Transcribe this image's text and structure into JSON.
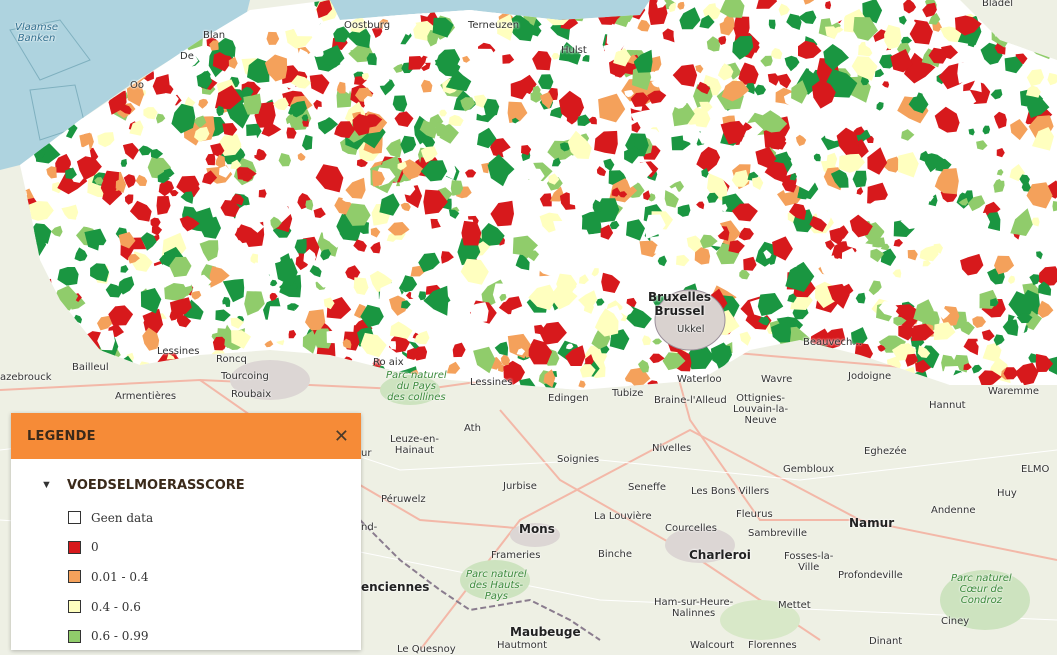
{
  "map": {
    "place_labels": {
      "vlaamse_banken": "Vlaamse\nBanken",
      "oostburg": "Oostburg",
      "terneuzen": "Terneuzen",
      "hulst": "Hulst",
      "bladel": "Bladel",
      "blan": "Blan",
      "de": "De",
      "oo": "Oo",
      "bruxelles": "Bruxelles\nBrussel",
      "ukkel": "Ukkel",
      "lessines1": "Lessines",
      "lessines2": "Lessines",
      "bailleul": "Bailleul",
      "roncq": "Roncq",
      "tourcoing": "Tourcoing",
      "roubaix": "Roubaix",
      "azebrouck": "azebrouck",
      "armentieres": "Armentières",
      "parc_pays_collines": "Parc naturel\ndu Pays\ndes collines",
      "ronse_aix": "Ro   aix",
      "edingen": "Edingen",
      "tubize": "Tubize",
      "waterloo": "Waterloo",
      "braine": "Braine-l'Alleud",
      "wavre": "Wavre",
      "ottignies": "Ottignies-\nLouvain-la-\nNeuve",
      "beauvechain": "Beauvech...",
      "jodoigne": "Jodoigne",
      "waremme": "Waremme",
      "hannut": "Hannut",
      "leuze": "Leuze-en-\nHainaut",
      "ath": "Ath",
      "soignies": "Soignies",
      "nivelles": "Nivelles",
      "gembloux": "Gembloux",
      "eghezee": "Eghezée",
      "peruwelz": "Péruwelz",
      "jurbise": "Jurbise",
      "seneffe": "Seneffe",
      "les_bons_villers": "Les Bons Villers",
      "fleurus": "Fleurus",
      "sambreville": "Sambreville",
      "namur": "Namur",
      "andenne": "Andenne",
      "huy": "Huy",
      "mons": "Mons",
      "la_louviere": "La Louvière",
      "courcelles": "Courcelles",
      "charleroi": "Charleroi",
      "fosses": "Fosses-la-\nVille",
      "profondeville": "Profondeville",
      "frameries": "Frameries",
      "binche": "Binche",
      "parc_hauts_pays": "Parc naturel\ndes Hauts-\nPays",
      "ham_sur_heure": "Ham-sur-Heure-\nNalinnes",
      "mettet": "Mettet",
      "parc_coeur_condroz": "Parc naturel\nCœur de\nCondroz",
      "ciney": "Ciney",
      "maubeuge": "Maubeuge",
      "hautmont": "Hautmont",
      "walcourt": "Walcourt",
      "florennes": "Florennes",
      "dinant": "Dinant",
      "valenciennes": "enciennes",
      "nd": "nd-",
      "ur": "ur",
      "elmo": "ELMO",
      "la_quesnoy": "Le Quesnoy"
    }
  },
  "legend": {
    "title": "LEGENDE",
    "close_icon": "close-icon",
    "layer": {
      "toggle_icon": "caret-down-icon",
      "title": "VOEDSELMOERASSCORE"
    },
    "items": [
      {
        "label": "Geen data",
        "color": "#ffffff"
      },
      {
        "label": "0",
        "color": "#d7191c"
      },
      {
        "label": "0.01 - 0.4",
        "color": "#f4a15b"
      },
      {
        "label": "0.4 - 0.6",
        "color": "#ffffbf"
      },
      {
        "label": "0.6 - 0.99",
        "color": "#90cc6b"
      }
    ]
  },
  "colors": {
    "score_0": "#d7191c",
    "score_low": "#f4a15b",
    "score_mid": "#ffffbf",
    "score_high": "#90cc6b",
    "score_top": "#1a9641",
    "no_data": "#ffffff",
    "sea": "#aed3df",
    "accent": "#f68b37"
  }
}
